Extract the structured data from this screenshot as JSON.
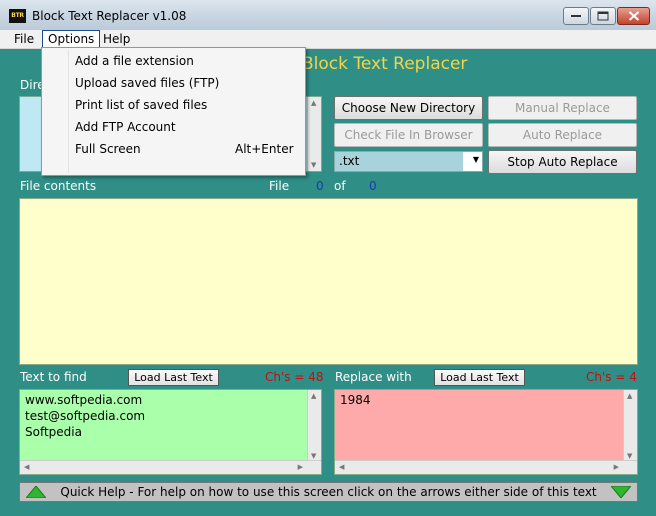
{
  "window": {
    "title": "Block Text Replacer v1.08",
    "icon_text": "BTR",
    "icon": "app-icon",
    "controls": [
      "minimize-icon",
      "maximize-icon",
      "close-icon"
    ]
  },
  "menubar": {
    "items": [
      "File",
      "Options",
      "Help"
    ]
  },
  "options_menu": {
    "items": [
      {
        "label": "Add a file extension",
        "shortcut": ""
      },
      {
        "label": "Upload saved files (FTP)",
        "shortcut": ""
      },
      {
        "label": "Print list of saved files",
        "shortcut": ""
      },
      {
        "label": "Add FTP Account",
        "shortcut": ""
      },
      {
        "label": "Full Screen",
        "shortcut": "Alt+Enter"
      }
    ]
  },
  "main": {
    "heading": "Block Text Replacer",
    "dir_label": "Dire",
    "buttons": {
      "choose_dir": "Choose New Directory",
      "check_file": "Check File In Browser",
      "manual_replace": "Manual Replace",
      "auto_replace": "Auto Replace",
      "stop_auto_replace": "Stop Auto Replace"
    },
    "extension_select": {
      "value": ".txt"
    },
    "file_contents": {
      "label": "File contents",
      "file_label": "File",
      "current": "0",
      "of_label": "of",
      "total": "0",
      "text": ""
    },
    "find": {
      "label": "Text to find",
      "load_button": "Load Last Text",
      "count": "Ch's = 48",
      "text": "www.softpedia.com\ntest@softpedia.com\nSoftpedia"
    },
    "replace": {
      "label": "Replace with",
      "load_button": "Load Last Text",
      "count": "Ch's = 4",
      "text": "1984"
    },
    "help_bar": {
      "text": "Quick Help - For help on how to use this screen click on the arrows either side of this text",
      "left_icon": "arrow-up-icon",
      "right_icon": "arrow-down-icon"
    }
  },
  "colors": {
    "background": "#2f8f87",
    "heading": "#f1d54a",
    "file_area": "#ffffcc",
    "find_area": "#aaffaa",
    "replace_area": "#ffaaaa",
    "dir_list": "#bfe8f5",
    "counter": "#1a3ab5",
    "count_text": "#c01010"
  }
}
